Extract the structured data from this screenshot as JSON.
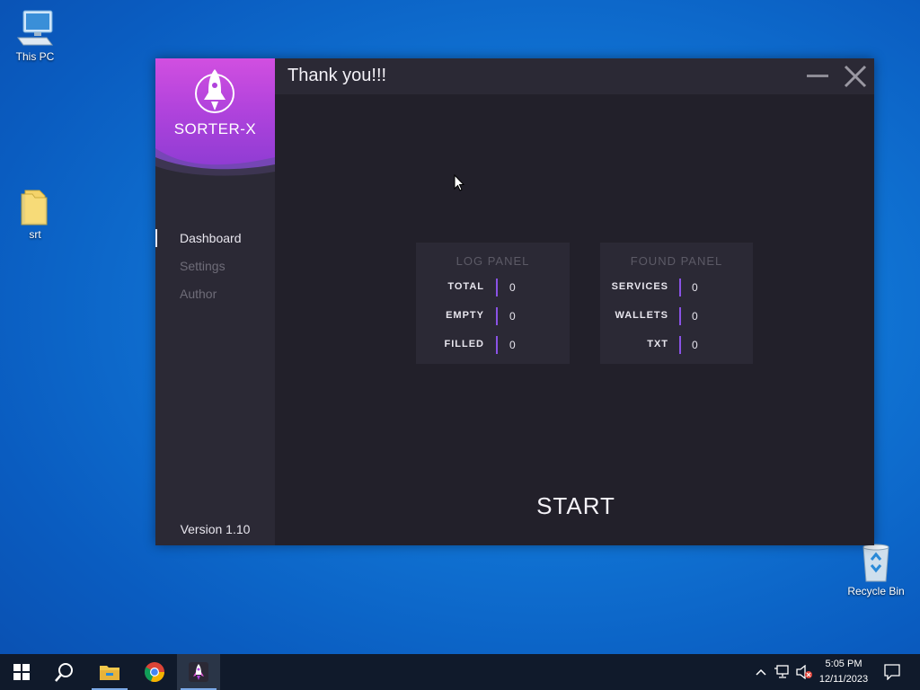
{
  "desktop": {
    "icons": [
      {
        "label": "This PC"
      },
      {
        "label": "srt"
      },
      {
        "label": "Recycle Bin"
      }
    ]
  },
  "app": {
    "brand_name": "SORTER-X",
    "title": "Thank you!!!",
    "nav": [
      {
        "label": "Dashboard",
        "active": true
      },
      {
        "label": "Settings",
        "active": false
      },
      {
        "label": "Author",
        "active": false
      }
    ],
    "version": "Version 1.10",
    "log_panel": {
      "title": "LOG PANEL",
      "rows": [
        {
          "label": "TOTAL",
          "value": "0"
        },
        {
          "label": "EMPTY",
          "value": "0"
        },
        {
          "label": "FILLED",
          "value": "0"
        }
      ]
    },
    "found_panel": {
      "title": "FOUND PANEL",
      "rows": [
        {
          "label": "SERVICES",
          "value": "0"
        },
        {
          "label": "WALLETS",
          "value": "0"
        },
        {
          "label": "TXT",
          "value": "0"
        }
      ]
    },
    "start_label": "START",
    "accent_color": "#8a52e6"
  },
  "taskbar": {
    "time": "5:05 PM",
    "date": "12/11/2023"
  }
}
